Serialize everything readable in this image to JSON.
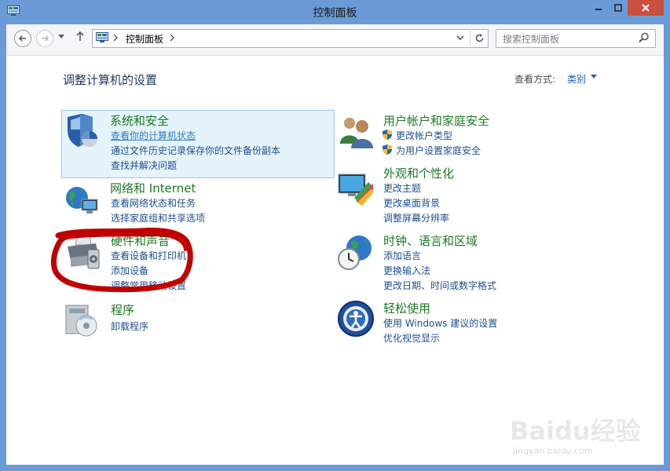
{
  "window": {
    "title": "控制面板"
  },
  "toolbar": {
    "address_segment": "控制面板",
    "search_placeholder": "搜索控制面板"
  },
  "main": {
    "heading": "调整计算机的设置",
    "view_by_label": "查看方式:",
    "view_by_value": "类别"
  },
  "categories": [
    {
      "title": "系统和安全",
      "links": [
        "查看你的计算机状态",
        "通过文件历史记录保存你的文件备份副本",
        "查找并解决问题"
      ]
    },
    {
      "title": "用户帐户和家庭安全",
      "links": [
        "更改帐户类型",
        "为用户设置家庭安全"
      ]
    },
    {
      "title": "网络和 Internet",
      "links": [
        "查看网络状态和任务",
        "选择家庭组和共享选项"
      ]
    },
    {
      "title": "外观和个性化",
      "links": [
        "更改主题",
        "更改桌面背景",
        "调整屏幕分辨率"
      ]
    },
    {
      "title": "硬件和声音",
      "links": [
        "查看设备和打印机",
        "添加设备",
        "调整常用移动设置"
      ]
    },
    {
      "title": "时钟、语言和区域",
      "links": [
        "添加语言",
        "更换输入法",
        "更改日期、时间或数字格式"
      ]
    },
    {
      "title": "程序",
      "links": [
        "卸载程序"
      ]
    },
    {
      "title": "轻松使用",
      "links": [
        "使用 Windows 建议的设置",
        "优化视觉显示"
      ]
    }
  ],
  "watermark": {
    "brand": "Baidu经验",
    "url": "jingyan.baidu.com"
  },
  "colors": {
    "title_bar": "#6b9bd6",
    "close_button": "#c7503f",
    "category_title": "#1c7a24",
    "link": "#1e4e8f",
    "annotation": "#c00000"
  }
}
